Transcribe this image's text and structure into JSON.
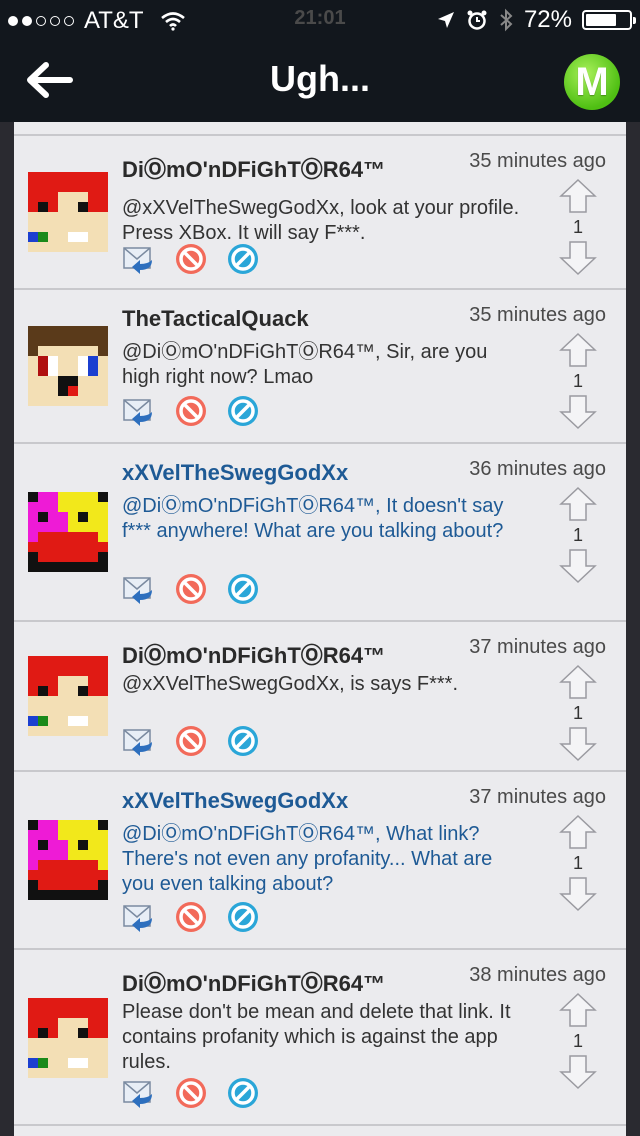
{
  "status_bar": {
    "carrier": "AT&T",
    "time": "21:01",
    "battery": "72%",
    "battery_level": 0.72,
    "signal_dots_filled": 2,
    "icons": [
      "wifi-icon",
      "location-icon",
      "alarm-icon",
      "bluetooth-icon",
      "battery-icon"
    ]
  },
  "nav": {
    "title": "Ugh...",
    "logo_letter": "M",
    "accent": "#55c41a"
  },
  "comments": [
    {
      "author": "DiⓄmO'nDFiGhTⓄR64™",
      "author_style": "dark",
      "time": "35 minutes ago",
      "text": "@xXVelTheSwegGodXx, look at your profile. Press XBox. It will say F***.",
      "text_style": "dark",
      "score": "1",
      "avatar": "red-hair"
    },
    {
      "author": "TheTacticalQuack",
      "author_style": "dark",
      "time": "35 minutes ago",
      "text": "@DiⓄmO'nDFiGhTⓄR64™, Sir, are you high right now? Lmao",
      "text_style": "dark",
      "score": "1",
      "avatar": "brown-hair"
    },
    {
      "author": "xXVelTheSwegGodXx",
      "author_style": "blue",
      "time": "36 minutes ago",
      "text": "@DiⓄmO'nDFiGhTⓄR64™, It doesn't say f*** anywhere! What are you talking about?",
      "text_style": "blue",
      "score": "1",
      "avatar": "pink-yellow"
    },
    {
      "author": "DiⓄmO'nDFiGhTⓄR64™",
      "author_style": "dark",
      "time": "37 minutes ago",
      "text": "@xXVelTheSwegGodXx, is says F***.",
      "text_style": "dark",
      "score": "1",
      "avatar": "red-hair"
    },
    {
      "author": "xXVelTheSwegGodXx",
      "author_style": "blue",
      "time": "37 minutes ago",
      "text": "@DiⓄmO'nDFiGhTⓄR64™, What link? There's not even any profanity... What are you even talking about?",
      "text_style": "blue",
      "score": "1",
      "avatar": "pink-yellow"
    },
    {
      "author": "DiⓄmO'nDFiGhTⓄR64™",
      "author_style": "dark",
      "time": "38 minutes ago",
      "text": "Please don't be mean and delete that link. It contains profanity which is against the app rules.",
      "text_style": "dark",
      "score": "1",
      "avatar": "red-hair"
    }
  ]
}
